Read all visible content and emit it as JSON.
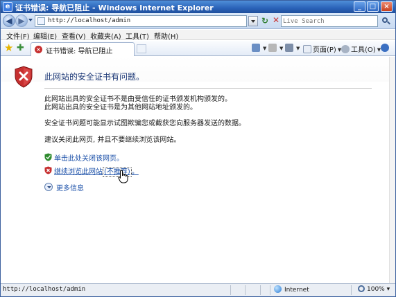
{
  "window": {
    "title": "证书错误: 导航已阻止 - Windows Internet Explorer"
  },
  "address_bar": {
    "url": "http://localhost/admin"
  },
  "search": {
    "placeholder": "Live Search"
  },
  "menu": {
    "items": [
      "文件(F)",
      "编辑(E)",
      "查看(V)",
      "收藏夹(A)",
      "工具(T)",
      "帮助(H)"
    ]
  },
  "tab": {
    "label": "证书错误: 导航已阻止"
  },
  "command_bar": {
    "page_label": "页面(P)",
    "tools_label": "工具(O)"
  },
  "content": {
    "heading": "此网站的安全证书有问题。",
    "para1_line1": "此网站出具的安全证书不是由受信任的证书颁发机构颁发的。",
    "para1_line2": "此网站出具的安全证书是为其他网站地址颁发的。",
    "para2": "安全证书问题可能显示试图欺骗您或截获您向服务器发送的数据。",
    "para3": "建议关闭此网页, 并且不要继续浏览该网站。",
    "link_close": "单击此处关闭该网页。",
    "link_continue": "继续浏览此网站",
    "link_continue_note": "(不推荐)",
    "link_continue_end": "。",
    "more_info": "更多信息"
  },
  "status_bar": {
    "text": "http://localhost/admin",
    "zone": "Internet",
    "zoom": "100%"
  },
  "colors": {
    "titlebar": "#2a62b8",
    "link": "#1a4fa8",
    "heading": "#1e3a78",
    "shield_red": "#c62f2f",
    "shield_green": "#2e8b2e"
  }
}
